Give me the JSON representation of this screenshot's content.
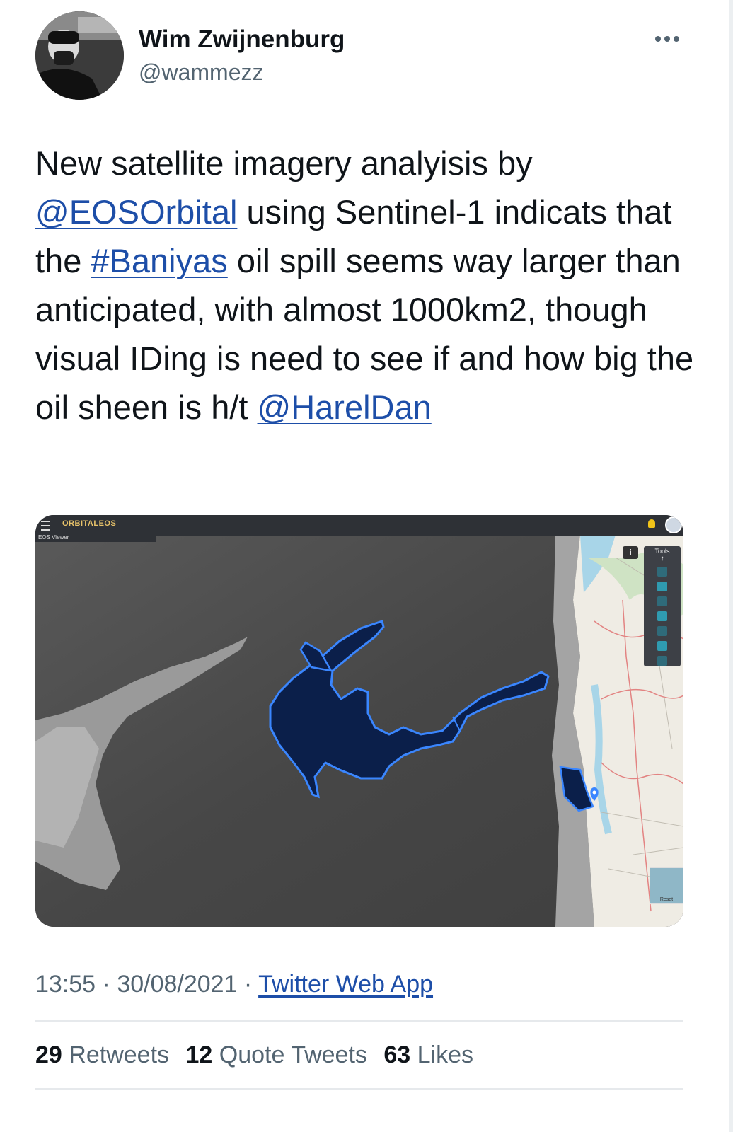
{
  "author": {
    "name": "Wim Zwijnenburg",
    "handle": "@wammezz"
  },
  "tweet": {
    "text_parts": {
      "p1": "New satellite imagery analyisis by ",
      "mention1": "@EOSOrbital",
      "p2": " using Sentinel-1 indicats that the ",
      "hashtag": "#Baniyas",
      "p3": " oil spill seems way larger than anticipated, with almost 1000km2, though visual IDing is need to see if and how big the oil sheen is h/t ",
      "mention2": "@HarelDan"
    }
  },
  "media": {
    "app_logo": "ORBITALEOS",
    "viewer_label": "EOS Viewer",
    "tools_label": "Tools",
    "reset_label": "Reset",
    "icons": [
      "bell-icon",
      "globe-icon",
      "info-icon",
      "lock-icon",
      "alert-icon",
      "layers-icon",
      "target-icon",
      "bag-icon",
      "download-icon",
      "file-icon"
    ]
  },
  "meta": {
    "time": "13:55",
    "sep1": " · ",
    "date": "30/08/2021",
    "sep2": " · ",
    "source": "Twitter Web App"
  },
  "stats": {
    "retweets_count": "29",
    "retweets_label": "Retweets",
    "quotes_count": "12",
    "quotes_label": "Quote Tweets",
    "likes_count": "63",
    "likes_label": "Likes"
  },
  "colors": {
    "text": "#0f1419",
    "secondary": "#536471",
    "link": "#1d4ea8",
    "spill_fill": "#0b1f4a",
    "spill_edge": "#3a86ff"
  }
}
